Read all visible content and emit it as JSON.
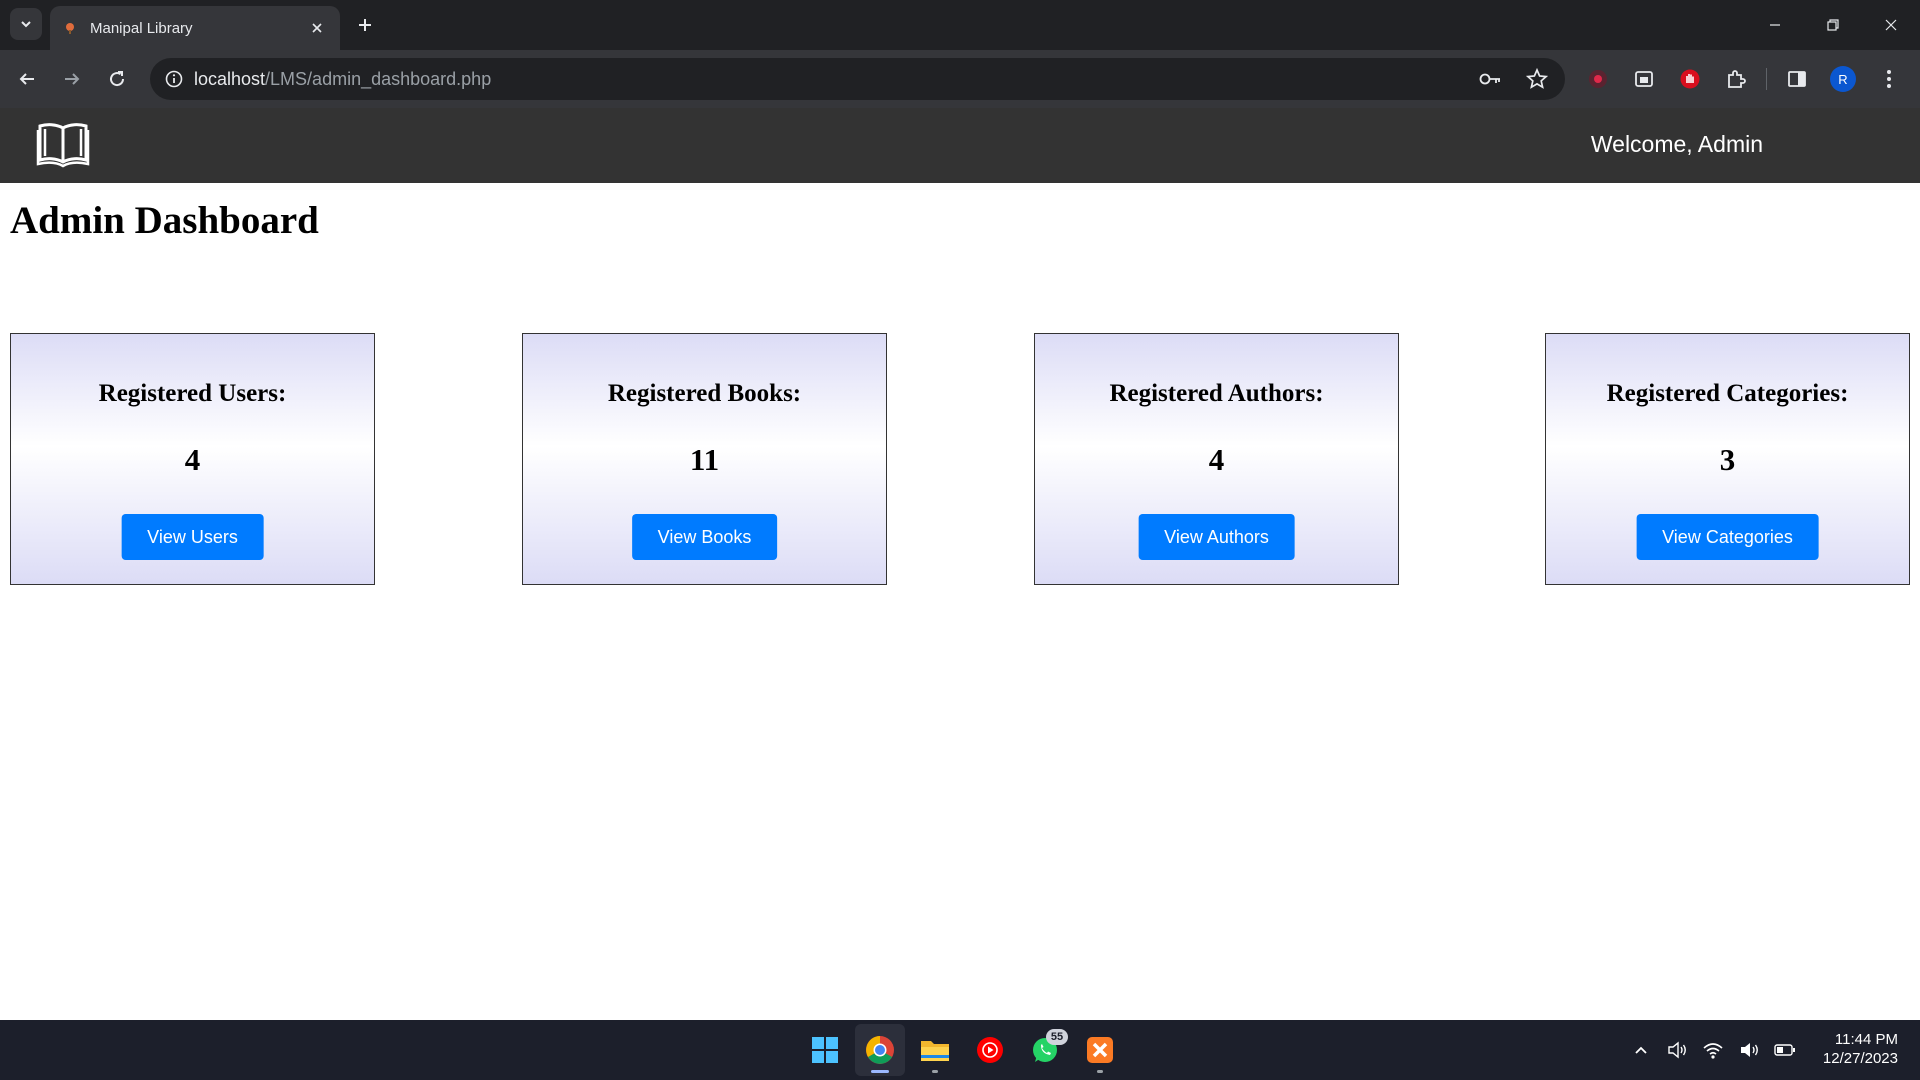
{
  "browser": {
    "tab_title": "Manipal Library",
    "url_host": "localhost",
    "url_path": "/LMS/admin_dashboard.php",
    "profile_initial": "R"
  },
  "navbar": {
    "welcome": "Welcome, Admin"
  },
  "page": {
    "title": "Admin Dashboard"
  },
  "cards": [
    {
      "label": "Registered Users:",
      "count": "4",
      "button": "View Users"
    },
    {
      "label": "Registered Books:",
      "count": "11",
      "button": "View Books"
    },
    {
      "label": "Registered Authors:",
      "count": "4",
      "button": "View Authors"
    },
    {
      "label": "Registered Categories:",
      "count": "3",
      "button": "View Categories"
    }
  ],
  "taskbar": {
    "whatsapp_badge": "55",
    "time": "11:44 PM",
    "date": "12/27/2023"
  },
  "colors": {
    "navbar": "#333333",
    "button": "#007bff",
    "card_tint": "#dcdcf6"
  }
}
